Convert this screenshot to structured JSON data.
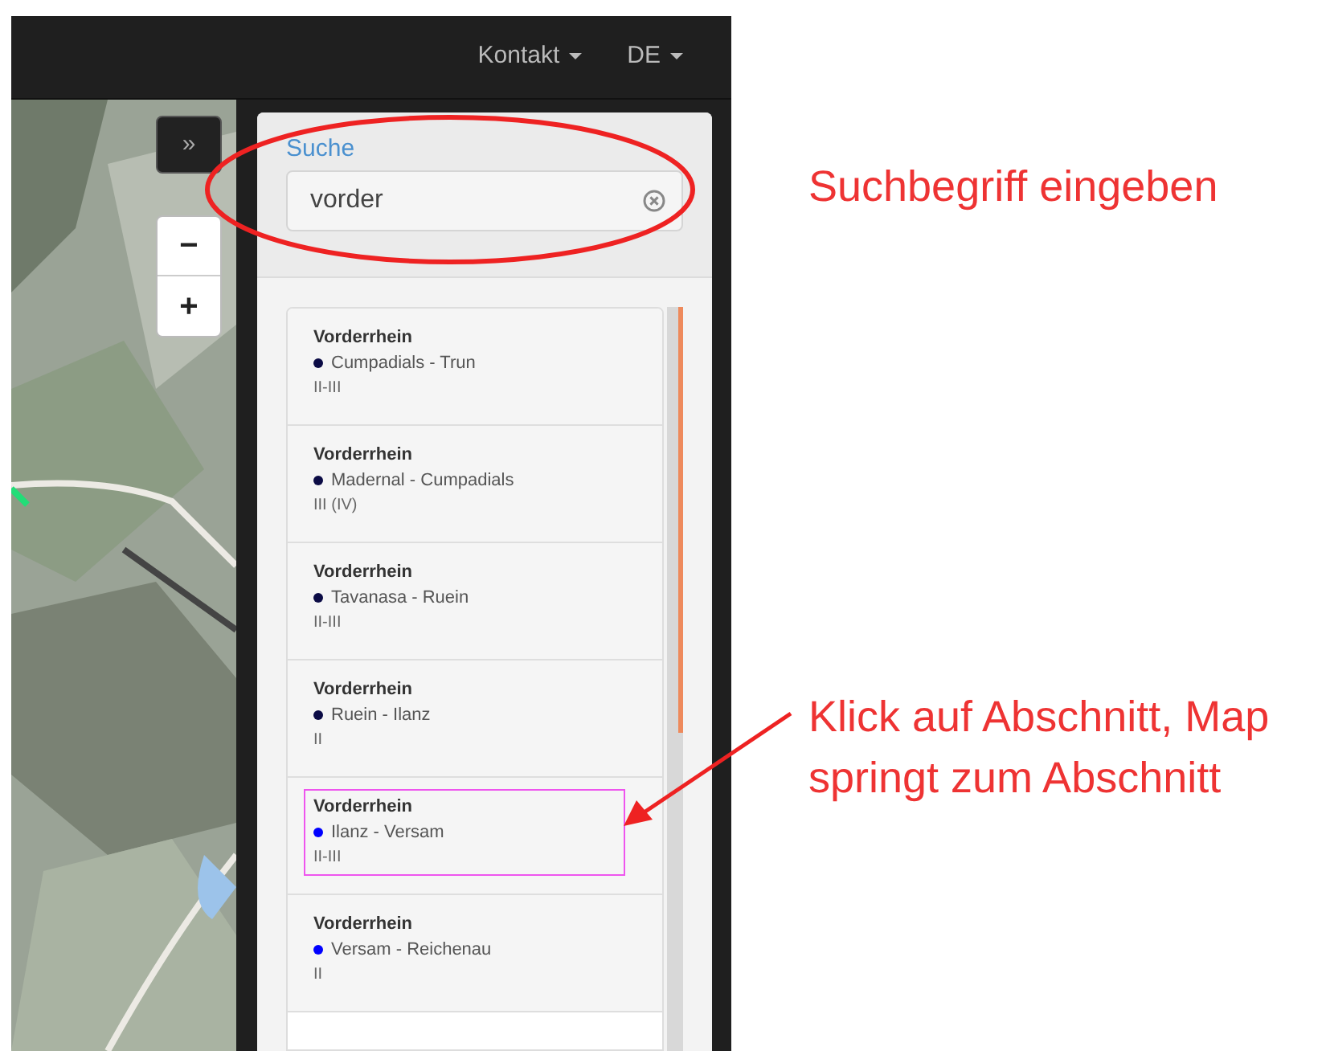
{
  "navbar": {
    "items": [
      {
        "label": "Kontakt"
      },
      {
        "label": "DE"
      }
    ]
  },
  "map": {
    "kind": "picture",
    "collapse_button": "»",
    "zoom_out": "−",
    "zoom_in": "+"
  },
  "search": {
    "label": "Suche",
    "value": "vorder"
  },
  "results": [
    {
      "river": "Vorderrhein",
      "section": "Cumpadials - Trun",
      "grade": "II-III",
      "color": "#0b0b45",
      "highlighted": false
    },
    {
      "river": "Vorderrhein",
      "section": "Madernal - Cumpadials",
      "grade": "III (IV)",
      "color": "#0b0b45",
      "highlighted": false
    },
    {
      "river": "Vorderrhein",
      "section": "Tavanasa - Ruein",
      "grade": "II-III",
      "color": "#0b0b45",
      "highlighted": false
    },
    {
      "river": "Vorderrhein",
      "section": "Ruein - Ilanz",
      "grade": "II",
      "color": "#0b0b45",
      "highlighted": false
    },
    {
      "river": "Vorderrhein",
      "section": "Ilanz - Versam",
      "grade": "II-III",
      "color": "#0000ff",
      "highlighted": true
    },
    {
      "river": "Vorderrhein",
      "section": "Versam - Reichenau",
      "grade": "II",
      "color": "#0000ff",
      "highlighted": false
    }
  ],
  "annotations": [
    {
      "text": "Suchbegriff eingeben"
    },
    {
      "text": "Klick auf Abschnitt, Map springt zum Abschnitt"
    }
  ]
}
